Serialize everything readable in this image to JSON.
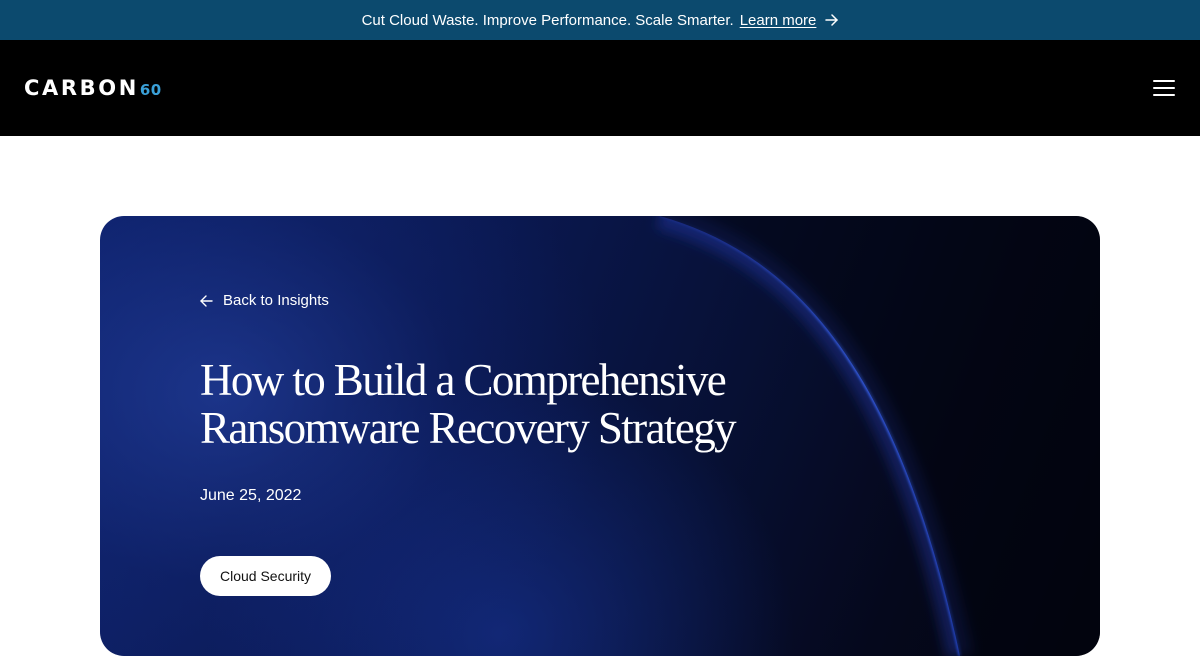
{
  "announcement": {
    "message": "Cut Cloud Waste. Improve Performance. Scale Smarter.",
    "link_label": "Learn more",
    "link_icon": "arrow-right-icon",
    "background": "#0c4a6e"
  },
  "header": {
    "logo_word": "CARBON",
    "logo_number": "60",
    "logo_accent_color": "#3aa0d8",
    "menu_icon": "hamburger-menu-icon",
    "background": "#000000"
  },
  "hero": {
    "back_label": "Back to Insights",
    "back_icon": "arrow-left-icon",
    "title": "How to Build a Comprehensive Ransomware Recovery Strategy",
    "date": "June 25, 2022",
    "tag": "Cloud Security",
    "accent_color": "#1e40af"
  }
}
